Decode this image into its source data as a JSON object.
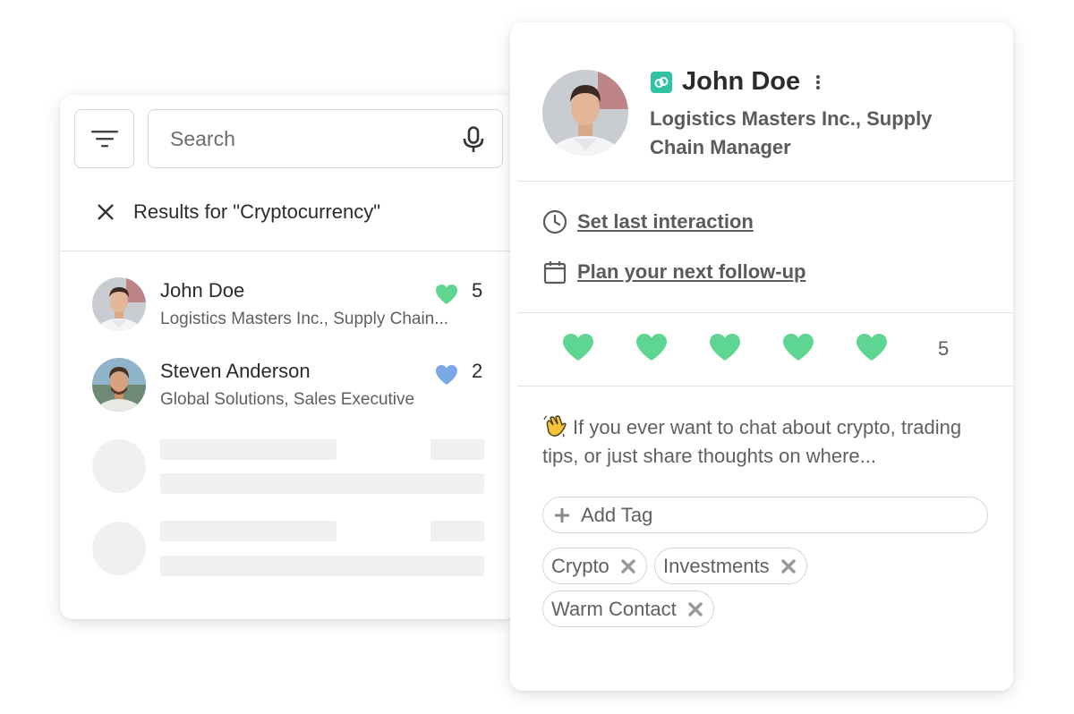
{
  "search_panel": {
    "filter_icon": "filter-lines-icon",
    "search_placeholder": "Search",
    "search_value": "",
    "mic_icon": "microphone-icon",
    "results_label": "Results for \"Cryptocurrency\"",
    "contacts": [
      {
        "name": "John Doe",
        "subtitle": "Logistics Masters Inc., Supply Chain...",
        "score": "5",
        "heart_color": "#5fd592"
      },
      {
        "name": "Steven Anderson",
        "subtitle": "Global Solutions, Sales Executive",
        "score": "2",
        "heart_color": "#7aa8e6"
      }
    ]
  },
  "profile": {
    "name": "John Doe",
    "title": "Logistics Masters Inc., Supply Chain Manager",
    "brand_color": "#2fc3a4",
    "actions": {
      "last_interaction": "Set last interaction",
      "follow_up": "Plan your next follow-up"
    },
    "rating": {
      "hearts": 5,
      "value": "5",
      "heart_color": "#5fd592"
    },
    "note": "If you ever want to chat about crypto, trading tips, or just share thoughts on where...",
    "add_tag_label": "Add Tag",
    "tags": [
      "Crypto",
      "Investments",
      "Warm Contact"
    ]
  }
}
